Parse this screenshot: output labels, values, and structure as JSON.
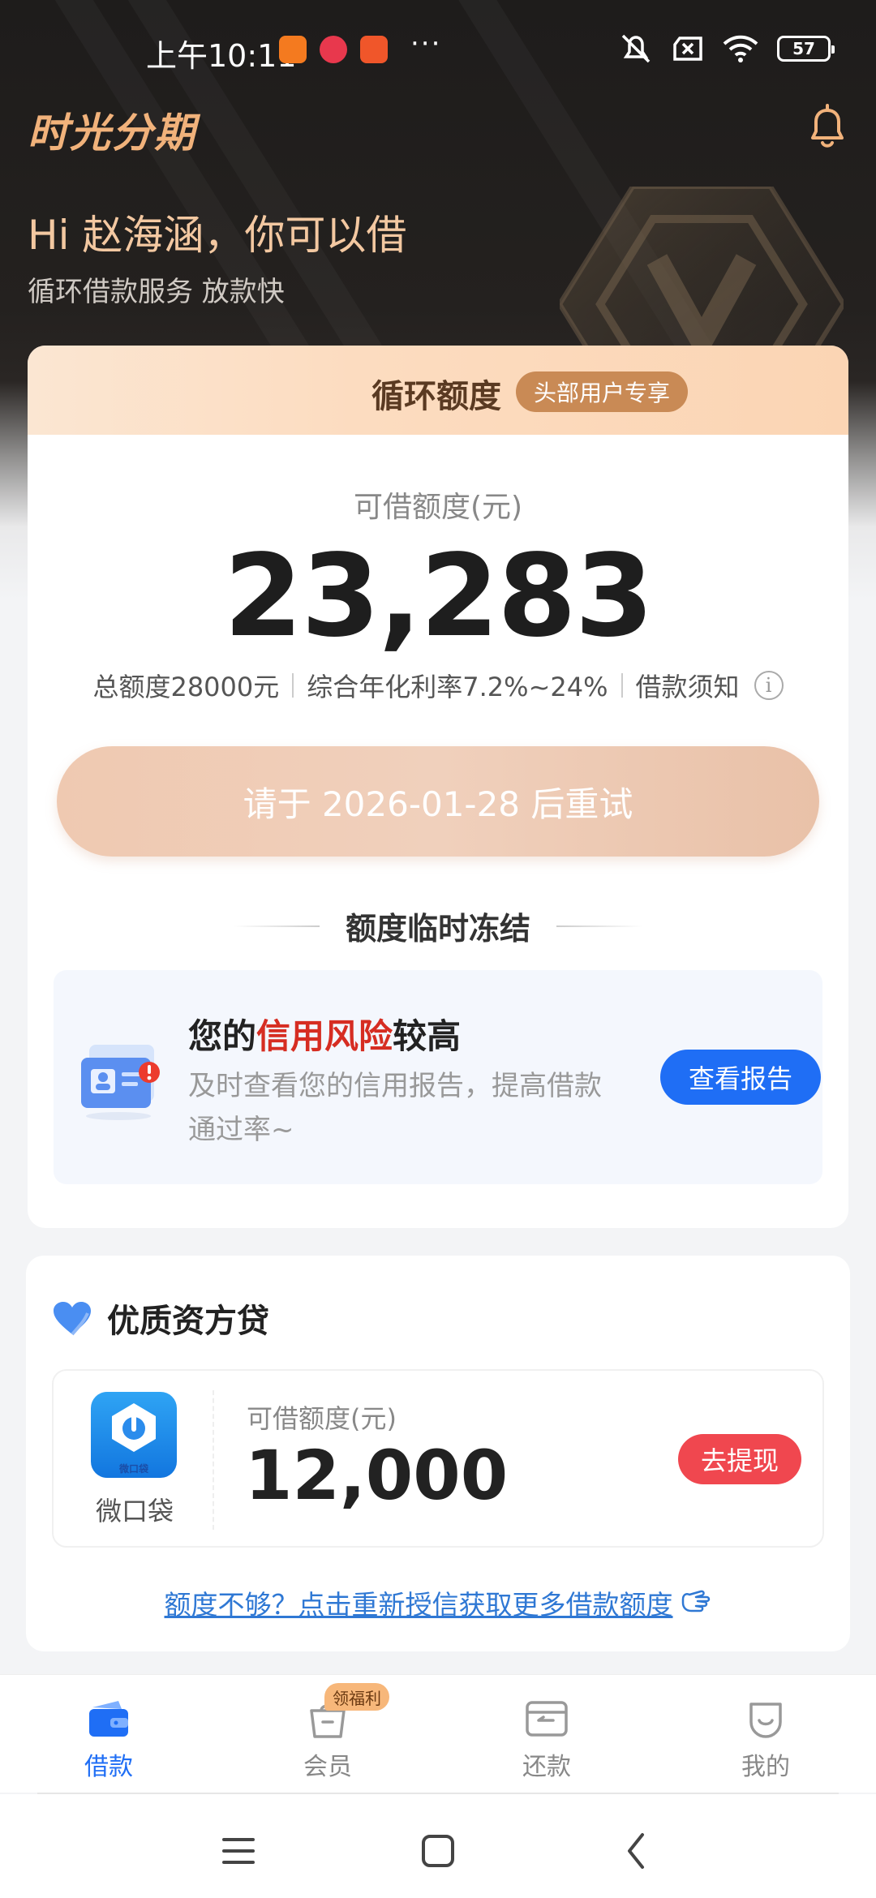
{
  "status_bar": {
    "time": "上午10:11",
    "dots": "···",
    "battery": "57"
  },
  "header": {
    "brand": "时光分期",
    "greeting": "Hi 赵海涵，你可以借",
    "subtitle": "循环借款服务 放款快"
  },
  "credit_card": {
    "banner_title": "循环额度",
    "banner_badge": "头部用户专享",
    "available_label": "可借额度(元)",
    "available_amount": "23,283",
    "total_limit": "总额度28000元",
    "rate": "综合年化利率7.2%~24%",
    "notice": "借款须知",
    "info_glyph": "i",
    "retry_button": "请于 2026-01-28 后重试",
    "freeze_title": "额度临时冻结",
    "risk": {
      "title_prefix": "您的",
      "title_highlight": "信用风险",
      "title_suffix": "较高",
      "description": "及时查看您的信用报告，提高借款通过率~",
      "button": "查看报告"
    }
  },
  "lender_section": {
    "title": "优质资方贷",
    "item": {
      "logo_text": "微口袋",
      "name": "微口袋",
      "label": "可借额度(元)",
      "amount": "12,000",
      "button": "去提现"
    },
    "reauth_link": "额度不够？点击重新授信获取更多借款额度"
  },
  "bottom_nav": {
    "items": [
      {
        "label": "借款",
        "icon": "wallet-icon",
        "active": true
      },
      {
        "label": "会员",
        "icon": "member-bag-icon",
        "badge": "领福利"
      },
      {
        "label": "还款",
        "icon": "repay-card-icon"
      },
      {
        "label": "我的",
        "icon": "profile-smile-icon"
      }
    ]
  },
  "colors": {
    "brand_orange": "#f1b27b",
    "primary_blue": "#1f6ef5",
    "risk_red": "#d62d22",
    "withdraw_red": "#f0474f"
  }
}
